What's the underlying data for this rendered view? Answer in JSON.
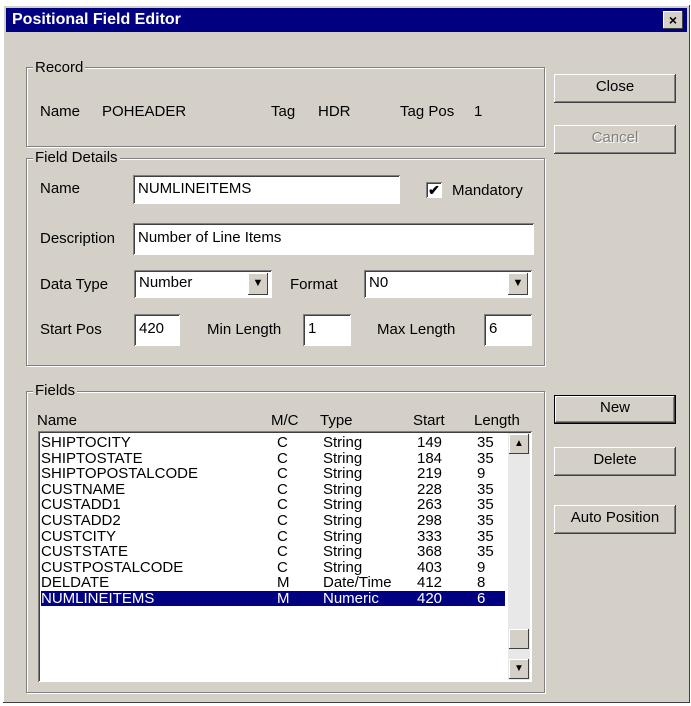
{
  "window": {
    "title": "Positional Field Editor",
    "close_glyph": "×"
  },
  "record": {
    "legend": "Record",
    "name_label": "Name",
    "name_value": "POHEADER",
    "tag_label": "Tag",
    "tag_value": "HDR",
    "tagpos_label": "Tag Pos",
    "tagpos_value": "1"
  },
  "details": {
    "legend": "Field Details",
    "name_label": "Name",
    "name_value": "NUMLINEITEMS",
    "mandatory_label": "Mandatory",
    "mandatory_checked": true,
    "check_glyph": "✔",
    "description_label": "Description",
    "description_value": "Number of Line Items",
    "datatype_label": "Data Type",
    "datatype_value": "Number",
    "format_label": "Format",
    "format_value": "N0",
    "startpos_label": "Start Pos",
    "startpos_value": "420",
    "minlen_label": "Min Length",
    "minlen_value": "1",
    "maxlen_label": "Max Length",
    "maxlen_value": "6",
    "dropdown_glyph": "▼"
  },
  "fields": {
    "legend": "Fields",
    "headers": {
      "name": "Name",
      "mc": "M/C",
      "type": "Type",
      "start": "Start",
      "length": "Length"
    },
    "rows": [
      {
        "name": "SHIPTOCITY",
        "mc": "C",
        "type": "String",
        "start": "149",
        "length": "35"
      },
      {
        "name": "SHIPTOSTATE",
        "mc": "C",
        "type": "String",
        "start": "184",
        "length": "35"
      },
      {
        "name": "SHIPTOPOSTALCODE",
        "mc": "C",
        "type": "String",
        "start": "219",
        "length": "9"
      },
      {
        "name": "CUSTNAME",
        "mc": "C",
        "type": "String",
        "start": "228",
        "length": "35"
      },
      {
        "name": "CUSTADD1",
        "mc": "C",
        "type": "String",
        "start": "263",
        "length": "35"
      },
      {
        "name": "CUSTADD2",
        "mc": "C",
        "type": "String",
        "start": "298",
        "length": "35"
      },
      {
        "name": "CUSTCITY",
        "mc": "C",
        "type": "String",
        "start": "333",
        "length": "35"
      },
      {
        "name": "CUSTSTATE",
        "mc": "C",
        "type": "String",
        "start": "368",
        "length": "35"
      },
      {
        "name": "CUSTPOSTALCODE",
        "mc": "C",
        "type": "String",
        "start": "403",
        "length": "9"
      },
      {
        "name": "DELDATE",
        "mc": "M",
        "type": "Date/Time",
        "start": "412",
        "length": "8"
      },
      {
        "name": "NUMLINEITEMS",
        "mc": "M",
        "type": "Numeric",
        "start": "420",
        "length": "6",
        "selected": true
      }
    ],
    "scroll_up_glyph": "▲",
    "scroll_down_glyph": "▼"
  },
  "buttons": {
    "close": "Close",
    "cancel": "Cancel",
    "new": "New",
    "delete": "Delete",
    "auto_position": "Auto Position"
  }
}
